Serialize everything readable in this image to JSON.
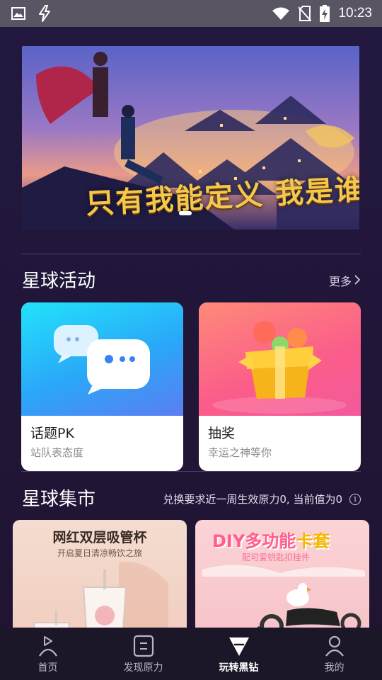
{
  "status_bar": {
    "time": "10:23"
  },
  "banner": {
    "caption": "只有我能定义 我是谁"
  },
  "activities": {
    "title": "星球活动",
    "more_label": "更多",
    "cards": [
      {
        "title": "话题PK",
        "subtitle": "站队表态度"
      },
      {
        "title": "抽奖",
        "subtitle": "幸运之神等你"
      }
    ]
  },
  "market": {
    "title": "星球集市",
    "note": "兑换要求近一周生效原力0, 当前值为0",
    "products": [
      {
        "headline": "网红双层吸管杯",
        "tagline": "开启夏日清凉畅饮之旅"
      },
      {
        "headline_prefix": "DIY多功能",
        "headline_suffix": "卡套",
        "tagline": "配可爱钥匙扣挂件"
      }
    ]
  },
  "tabbar": {
    "tabs": [
      {
        "label": "首页",
        "icon": "home-play-icon"
      },
      {
        "label": "发现原力",
        "icon": "discover-icon"
      },
      {
        "label": "玩转黑钻",
        "icon": "diamond-icon",
        "active": true
      },
      {
        "label": "我的",
        "icon": "profile-icon"
      }
    ]
  },
  "colors": {
    "background": "#201639",
    "status_bar": "#595562",
    "tabbar": "#1b1628",
    "activity_blue": "#2ad6fb",
    "activity_pink": "#fb5c8a"
  }
}
